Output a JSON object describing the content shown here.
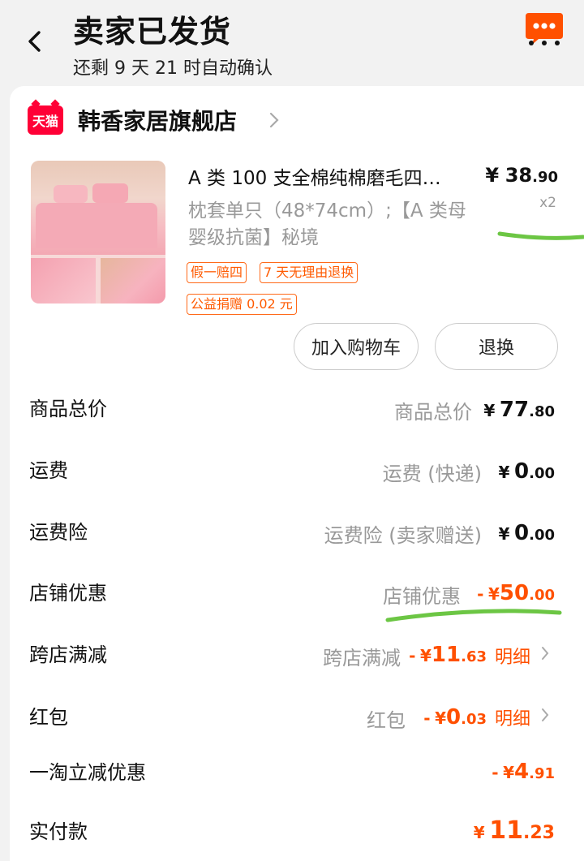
{
  "header": {
    "title": "卖家已发货",
    "subtitle": "还剩 9 天 21 时自动确认"
  },
  "shop": {
    "logo_text": "天猫",
    "name": "韩香家居旗舰店"
  },
  "product": {
    "title": "A 类 100 支全棉纯棉磨毛四…",
    "spec": "枕套单只（48*74cm）;【A 类母婴级抗菌】秘境",
    "price_symbol": "¥",
    "price_int": "38",
    "price_dec": ".90",
    "quantity": "x2",
    "tags": [
      "假一赔四",
      "7 天无理由退换",
      "公益捐赠 0.02 元"
    ],
    "buttons": {
      "add_cart": "加入购物车",
      "return": "退换"
    }
  },
  "summary": {
    "rows": [
      {
        "label": "商品总价",
        "desc": "商品总价",
        "sign": "",
        "int": "77",
        "dec": ".80",
        "color": "#111111"
      },
      {
        "label": "运费",
        "desc": "运费 (快递)",
        "sign": "",
        "int": "0",
        "dec": ".00",
        "color": "#111111"
      },
      {
        "label": "运费险",
        "desc": "运费险 (卖家赠送)",
        "sign": "",
        "int": "0",
        "dec": ".00",
        "color": "#111111"
      },
      {
        "label": "店铺优惠",
        "desc": "店铺优惠",
        "sign": "-",
        "int": "50",
        "dec": ".00",
        "color": "#ff5000"
      },
      {
        "label": "跨店满减",
        "desc": "跨店满减",
        "sign": "-",
        "int": "11",
        "dec": ".63",
        "color": "#ff5000",
        "link": "明细"
      },
      {
        "label": "红包",
        "desc": "红包",
        "sign": "-",
        "int": "0",
        "dec": ".03",
        "color": "#ff5000",
        "link": "明细"
      },
      {
        "label": "一淘立减优惠",
        "desc": "",
        "sign": "-",
        "int": "4",
        "dec": ".91",
        "color": "#ff5000"
      },
      {
        "label": "实付款",
        "desc": "",
        "sign": "",
        "int": "11",
        "dec": ".23",
        "color": "#ff5000"
      }
    ],
    "currency": "¥"
  },
  "icons": {
    "back": "chevron-left-icon",
    "more": "chat-more-icon",
    "shop_chevron": "chevron-right-icon",
    "detail_chevron": "chevron-right-icon"
  },
  "colors": {
    "accent": "#ff5000",
    "highlight_pen": "#6cc644"
  }
}
